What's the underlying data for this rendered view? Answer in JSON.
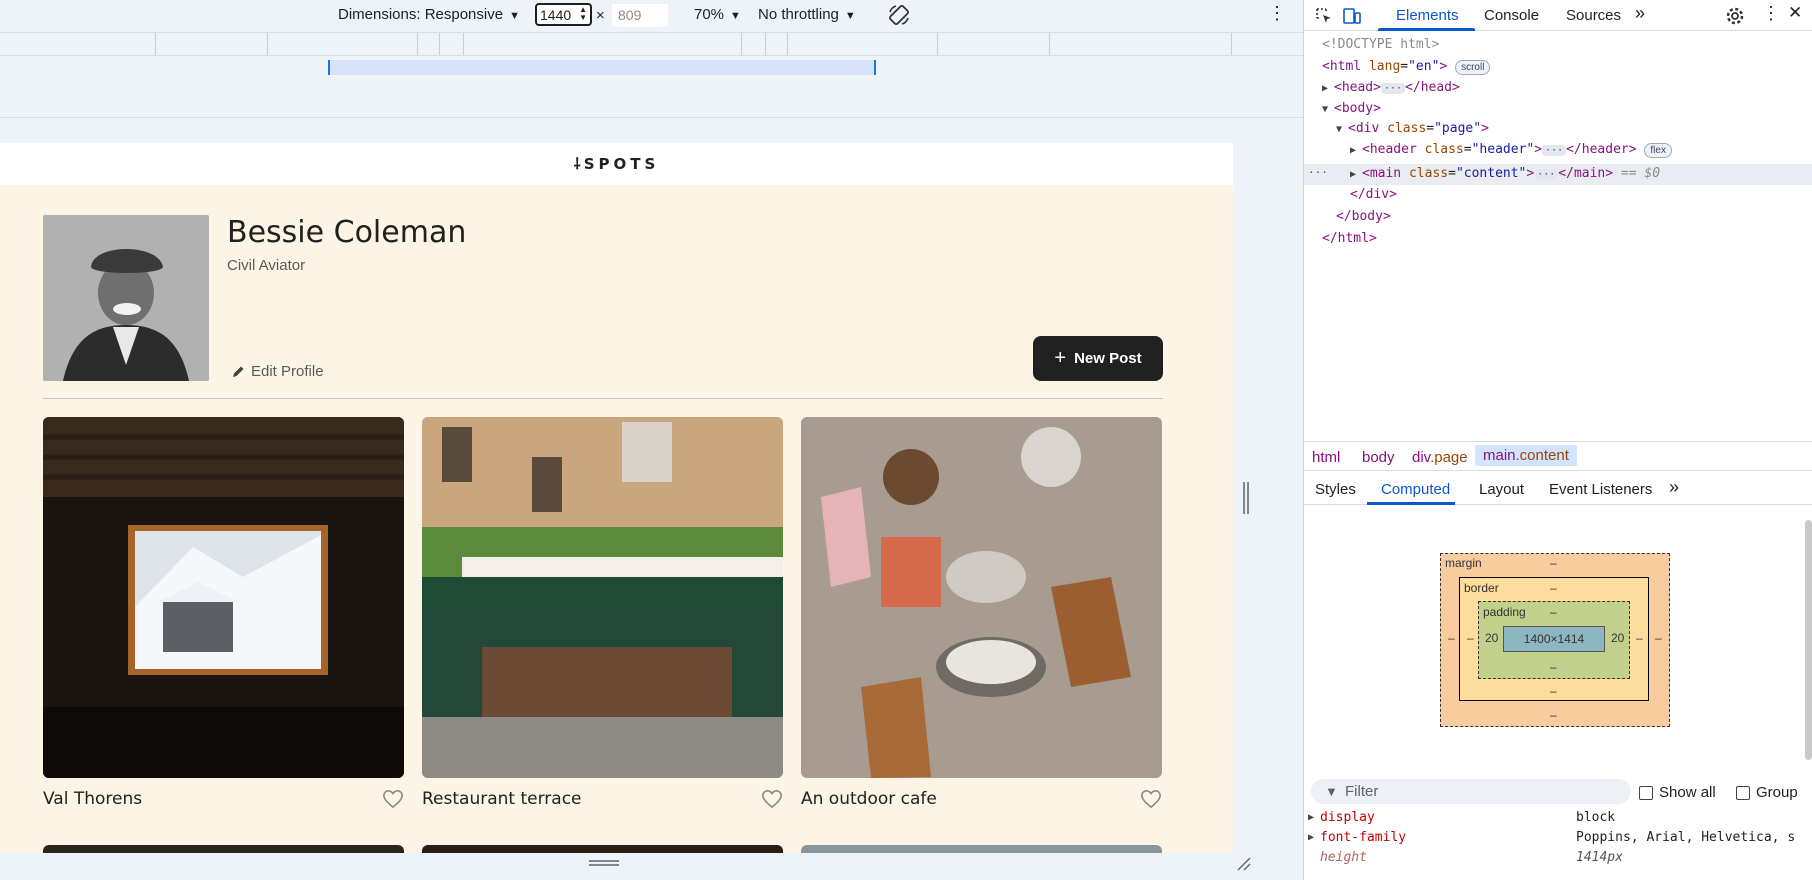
{
  "device_toolbar": {
    "dimensions_label": "Dimensions: Responsive",
    "width_value": "1440",
    "times": "×",
    "height_placeholder": "809",
    "zoom": "70%",
    "throttling": "No throttling"
  },
  "page": {
    "logo": "SPOTS",
    "logo_mark": "⸸",
    "profile": {
      "name": "Bessie Coleman",
      "job": "Civil Aviator",
      "edit_label": "Edit Profile",
      "new_post_label": "New Post"
    },
    "cards": [
      {
        "title": "Val Thorens"
      },
      {
        "title": "Restaurant terrace"
      },
      {
        "title": "An outdoor cafe"
      }
    ]
  },
  "devtools": {
    "tabs": [
      "Elements",
      "Console",
      "Sources"
    ],
    "more_tabs": "»",
    "dom": {
      "doctype": "<!DOCTYPE html>",
      "html_open": "html",
      "html_attr": "lang",
      "html_val": "\"en\"",
      "scroll_badge": "scroll",
      "head": "head",
      "body": "body",
      "div": "div",
      "div_class": "\"page\"",
      "header": "header",
      "header_class": "\"header\"",
      "flex_badge": "flex",
      "main": "main",
      "main_class": "\"content\"",
      "eq": "== $0",
      "class_attr": "class",
      "close_div": "</div>",
      "close_body": "</body>",
      "close_html": "</html>"
    },
    "breadcrumbs": [
      {
        "tag": "html",
        "cls": ""
      },
      {
        "tag": "body",
        "cls": ""
      },
      {
        "tag": "div",
        "cls": ".page"
      },
      {
        "tag": "main",
        "cls": ".content"
      }
    ],
    "sub_tabs": [
      "Styles",
      "Computed",
      "Layout",
      "Event Listeners"
    ],
    "box_model": {
      "margin": "margin",
      "border": "border",
      "padding": "padding",
      "dash": "–",
      "padding_left": "20",
      "padding_right": "20",
      "content": "1400×1414"
    },
    "filter_placeholder": "Filter",
    "show_all": "Show all",
    "group": "Group",
    "computed": [
      {
        "name": "display",
        "value": "block"
      },
      {
        "name": "font-family",
        "value": "Poppins, Arial, Helvetica, s"
      },
      {
        "name": "height",
        "value": "1414px"
      }
    ]
  },
  "colors": {
    "accent": "#0b57d0",
    "page_bg": "#fcf5e5",
    "button_bg": "#212121"
  }
}
